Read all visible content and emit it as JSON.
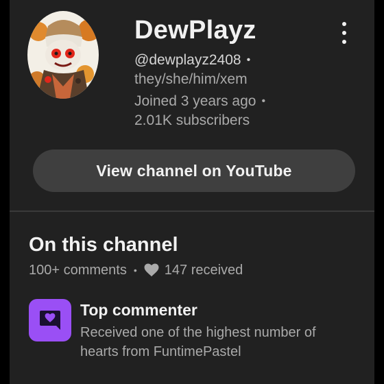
{
  "channel": {
    "name": "DewPlayz",
    "handle": "@dewplayz2408",
    "pronouns": "they/she/him/xem",
    "joined": "Joined 3 years ago",
    "subscribers": "2.01K subscribers",
    "separator": "•"
  },
  "actions": {
    "view_channel_label": "View channel on YouTube"
  },
  "on_channel": {
    "title": "On this channel",
    "comments": "100+ comments",
    "separator": "•",
    "hearts_received": "147 received"
  },
  "top_commenter": {
    "title": "Top commenter",
    "description": "Received one of the highest number of hearts from FuntimePastel"
  },
  "colors": {
    "panel_bg": "#212121",
    "badge": "#9a4ff5",
    "button_bg": "#3f3f3f",
    "text_primary": "#f1f1f1",
    "text_secondary": "#aaaaaa"
  },
  "icons": {
    "more": "more-vert-icon",
    "heart": "heart-icon",
    "badge": "heart-chat-badge-icon"
  }
}
